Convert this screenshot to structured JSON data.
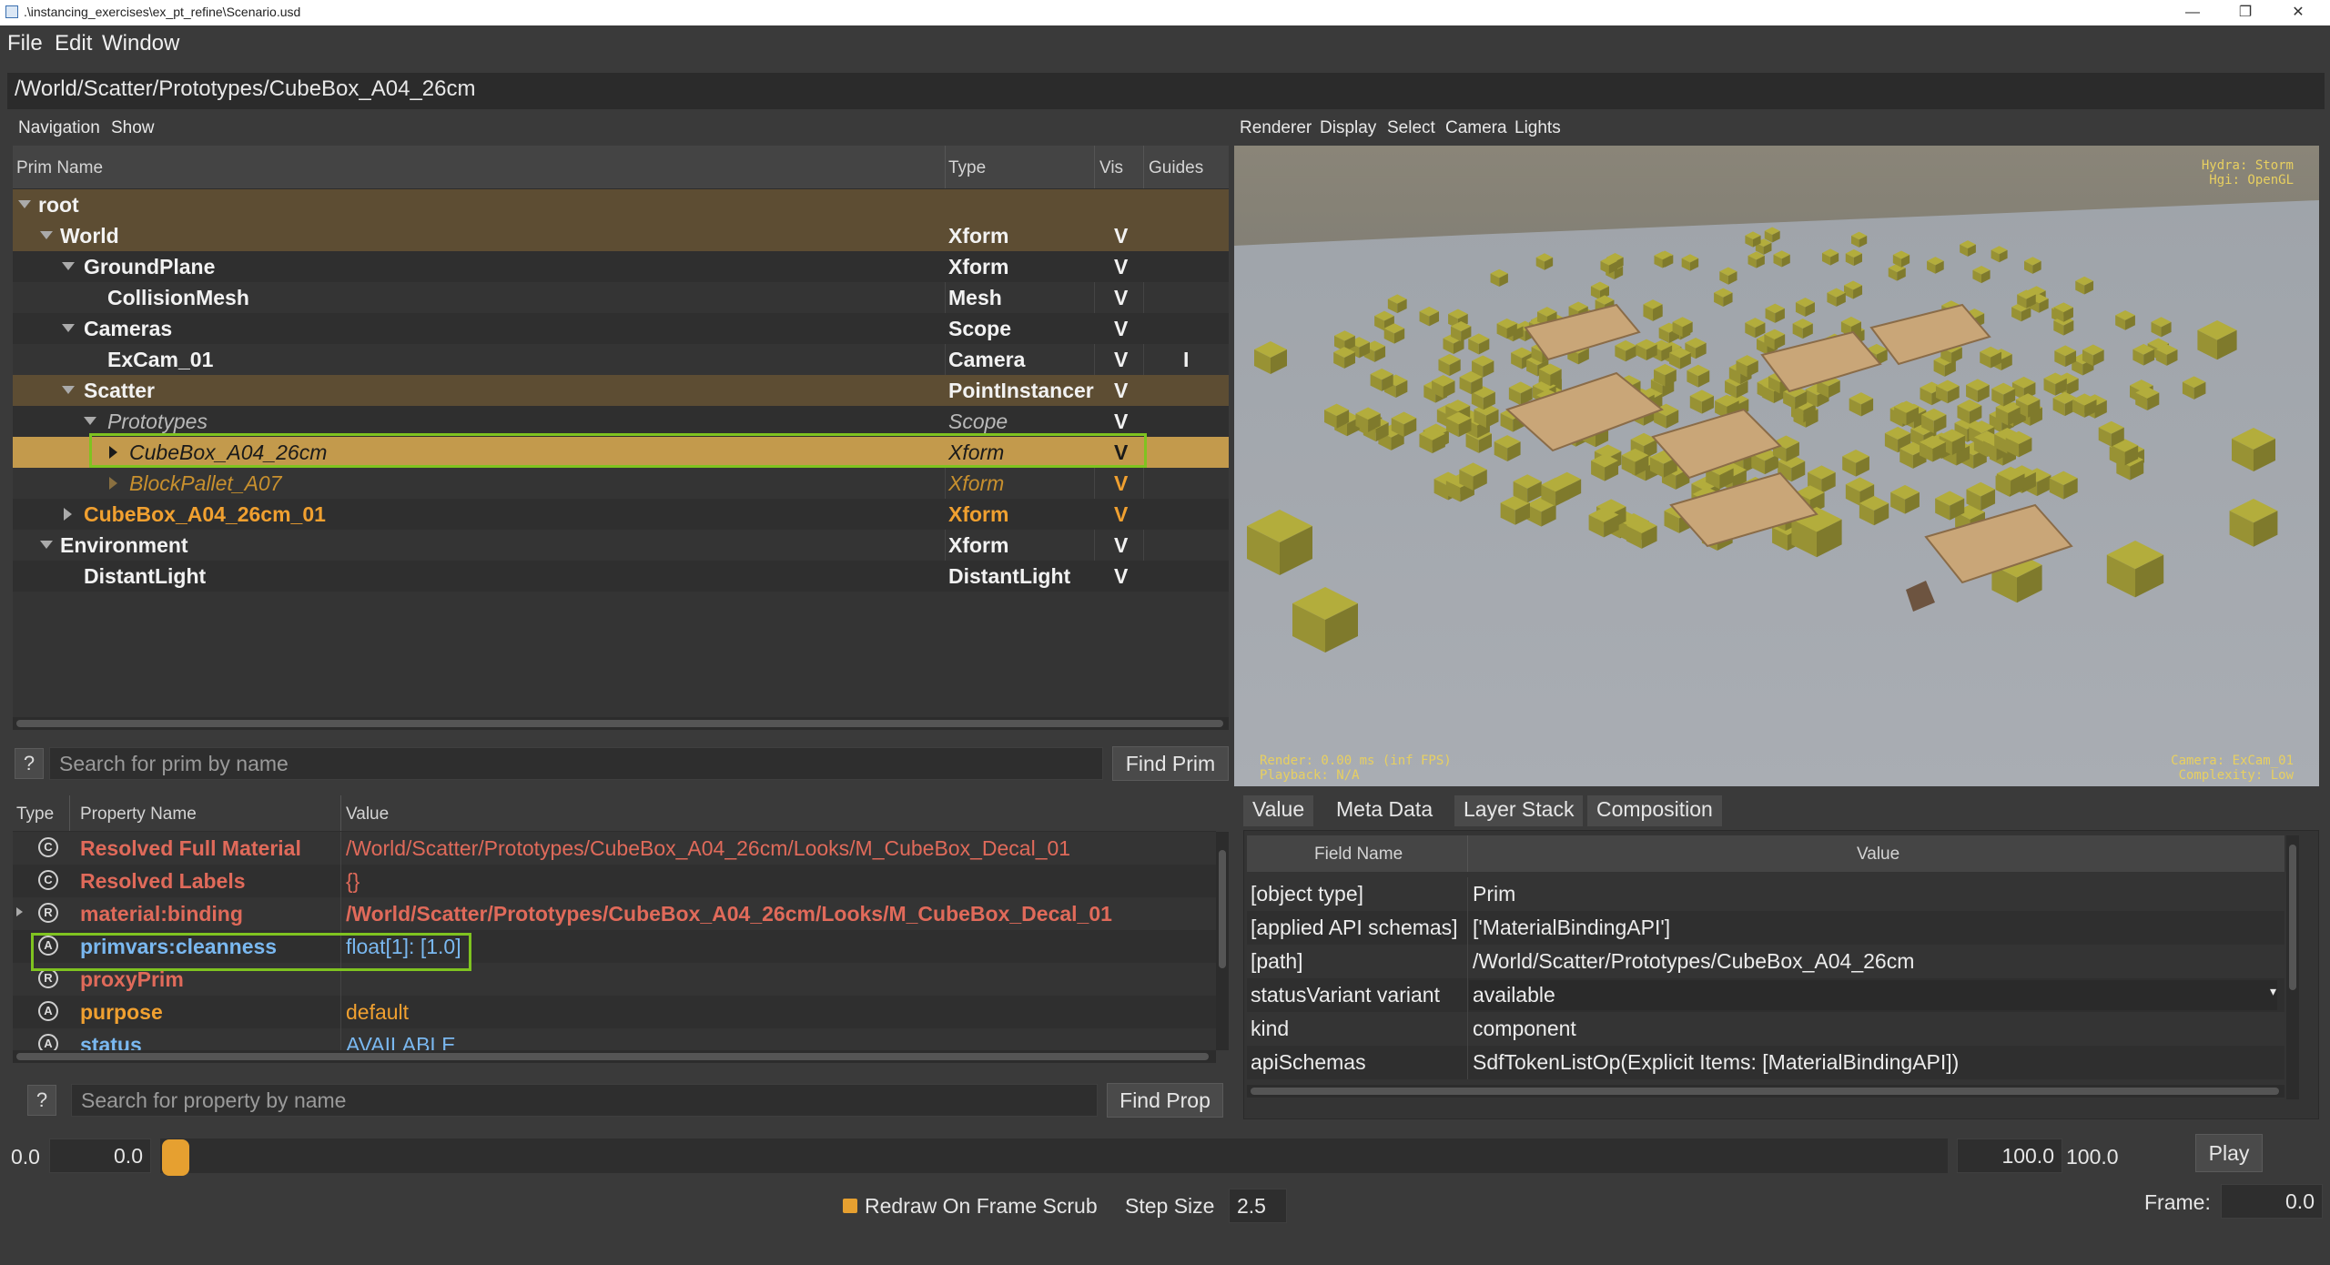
{
  "window": {
    "title": ".\\instancing_exercises\\ex_pt_refine\\Scenario.usd",
    "minimize": "—",
    "maximize": "❐",
    "close": "✕"
  },
  "menu": [
    "File",
    "Edit",
    "Window"
  ],
  "path": "/World/Scatter/Prototypes/CubeBox_A04_26cm",
  "nav_menu": [
    "Navigation",
    "Show"
  ],
  "tree": {
    "columns": {
      "name": "Prim Name",
      "type": "Type",
      "vis": "Vis",
      "guides": "Guides"
    },
    "rows": [
      {
        "name": "root",
        "type": "",
        "vis": "",
        "guide": ""
      },
      {
        "name": "World",
        "type": "Xform",
        "vis": "V",
        "guide": ""
      },
      {
        "name": "GroundPlane",
        "type": "Xform",
        "vis": "V",
        "guide": ""
      },
      {
        "name": "CollisionMesh",
        "type": "Mesh",
        "vis": "V",
        "guide": ""
      },
      {
        "name": "Cameras",
        "type": "Scope",
        "vis": "V",
        "guide": ""
      },
      {
        "name": "ExCam_01",
        "type": "Camera",
        "vis": "V",
        "guide": "I"
      },
      {
        "name": "Scatter",
        "type": "PointInstancer",
        "vis": "V",
        "guide": ""
      },
      {
        "name": "Prototypes",
        "type": "Scope",
        "vis": "V",
        "guide": ""
      },
      {
        "name": "CubeBox_A04_26cm",
        "type": "Xform",
        "vis": "V",
        "guide": ""
      },
      {
        "name": "BlockPallet_A07",
        "type": "Xform",
        "vis": "V",
        "guide": ""
      },
      {
        "name": "CubeBox_A04_26cm_01",
        "type": "Xform",
        "vis": "V",
        "guide": ""
      },
      {
        "name": "Environment",
        "type": "Xform",
        "vis": "V",
        "guide": ""
      },
      {
        "name": "DistantLight",
        "type": "DistantLight",
        "vis": "V",
        "guide": ""
      }
    ]
  },
  "prim_search": {
    "help": "?",
    "placeholder": "Search for prim by name",
    "button": "Find Prim"
  },
  "properties": {
    "columns": {
      "type": "Type",
      "name": "Property Name",
      "value": "Value"
    },
    "rows": [
      {
        "icon": "C",
        "name": "Resolved Full Material",
        "value": "/World/Scatter/Prototypes/CubeBox_A04_26cm/Looks/M_CubeBox_Decal_01"
      },
      {
        "icon": "C",
        "name": "Resolved Labels",
        "value": "{}"
      },
      {
        "icon": "R",
        "name": "material:binding",
        "value": "/World/Scatter/Prototypes/CubeBox_A04_26cm/Looks/M_CubeBox_Decal_01"
      },
      {
        "icon": "A",
        "name": "primvars:cleanness",
        "value": "float[1]: [1.0]"
      },
      {
        "icon": "R",
        "name": "proxyPrim",
        "value": ""
      },
      {
        "icon": "A",
        "name": "purpose",
        "value": "default"
      },
      {
        "icon": "A",
        "name": "status",
        "value": "AVAILABLE"
      }
    ]
  },
  "prop_search": {
    "help": "?",
    "placeholder": "Search for property by name",
    "button": "Find Prop"
  },
  "viewport": {
    "menu": [
      "Renderer",
      "Display",
      "Select",
      "Camera",
      "Lights"
    ],
    "hud_top_right": [
      "Hydra: Storm",
      "Hgi: OpenGL"
    ],
    "hud_bottom_left": [
      "Render: 0.00 ms (inf FPS)",
      "Playback: N/A"
    ],
    "hud_bottom_right": [
      "Camera: ExCam_01",
      "Complexity: Low"
    ]
  },
  "inspector": {
    "tabs": [
      "Value",
      "Meta Data",
      "Layer Stack",
      "Composition"
    ],
    "active_tab": "Meta Data",
    "columns": {
      "field": "Field Name",
      "value": "Value"
    },
    "rows": [
      {
        "field": "[object type]",
        "value": "Prim"
      },
      {
        "field": "[applied API schemas]",
        "value": "['MaterialBindingAPI']"
      },
      {
        "field": "[path]",
        "value": "/World/Scatter/Prototypes/CubeBox_A04_26cm"
      },
      {
        "field": "statusVariant variant",
        "value": "available"
      },
      {
        "field": "kind",
        "value": "component"
      },
      {
        "field": "apiSchemas",
        "value": "SdfTokenListOp(Explicit Items: [MaterialBindingAPI])"
      }
    ]
  },
  "timeline": {
    "start_label": "0.0",
    "start_value": "0.0",
    "end_value": "100.0",
    "end_label": "100.0",
    "play": "Play",
    "redraw_label": "Redraw On Frame Scrub",
    "step_label": "Step Size",
    "step_value": "2.5",
    "frame_label": "Frame:",
    "frame_value": "0.0"
  },
  "colors": {
    "selection": "#c39a4c",
    "highlight_box": "#7fc320",
    "accent_orange": "#f0a030"
  }
}
